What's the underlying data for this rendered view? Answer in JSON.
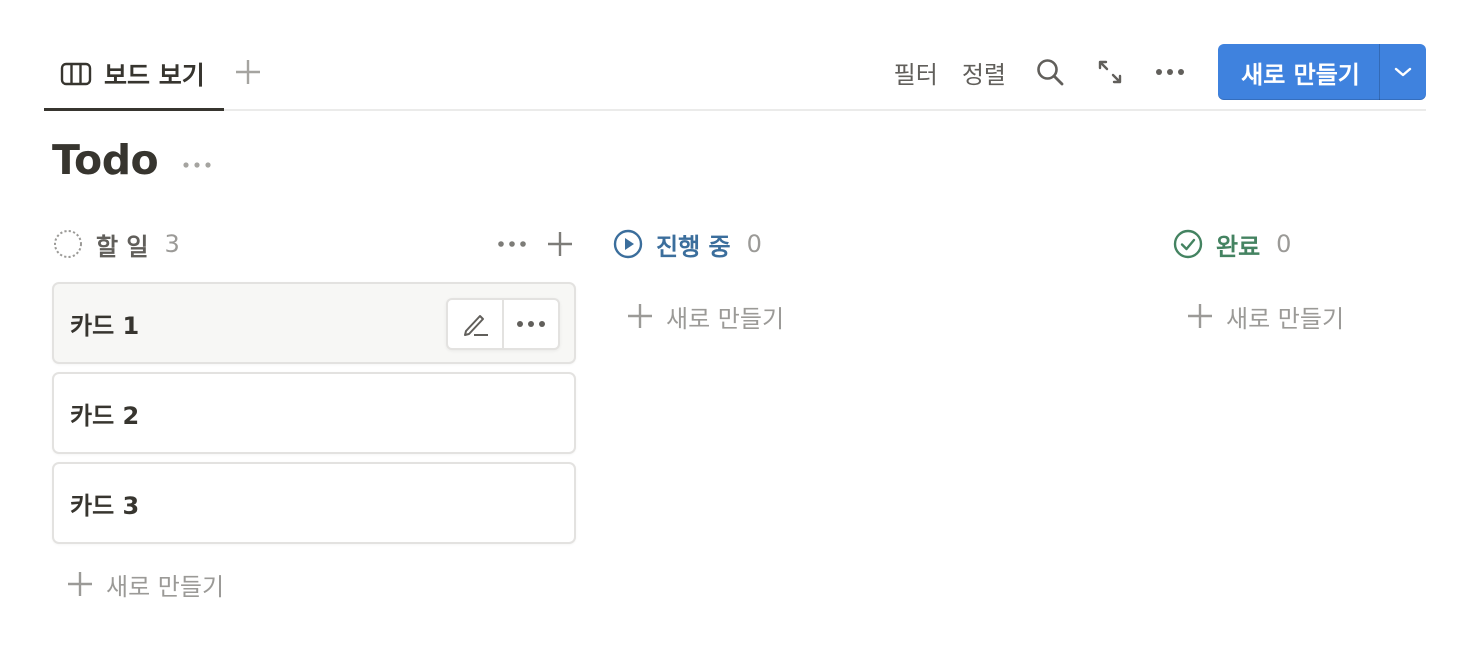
{
  "view": {
    "tab_label": "보드 보기",
    "add_view_icon": "plus-icon",
    "board_icon": "board-columns-icon"
  },
  "toolbar": {
    "filter_label": "필터",
    "sort_label": "정렬",
    "search_icon": "search-icon",
    "expand_icon": "expand-arrows-icon",
    "more_icon": "more-horizontal-icon",
    "new_button_label": "새로 만들기",
    "new_button_caret_icon": "chevron-down-icon",
    "new_button_color": "#3f82de"
  },
  "database": {
    "title": "Todo",
    "more_icon": "more-horizontal-icon"
  },
  "columns": [
    {
      "name": "할 일",
      "count": "3",
      "color": "#615f5b",
      "icon": "dotted-circle-icon",
      "cards": [
        "카드 1",
        "카드 2",
        "카드 3"
      ],
      "add_label": "새로 만들기"
    },
    {
      "name": "진행 중",
      "count": "0",
      "color": "#3b6e9c",
      "icon": "play-circle-icon",
      "cards": [],
      "add_label": "새로 만들기"
    },
    {
      "name": "완료",
      "count": "0",
      "color": "#448361",
      "icon": "check-circle-icon",
      "cards": [],
      "add_label": "새로 만들기"
    }
  ],
  "card_hover_actions": {
    "edit_icon": "pencil-icon",
    "more_icon": "more-horizontal-icon"
  }
}
